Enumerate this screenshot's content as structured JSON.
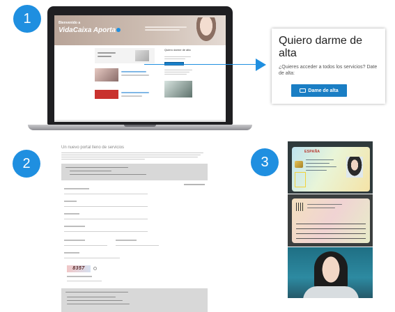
{
  "steps": [
    "1",
    "2",
    "3"
  ],
  "laptop_site": {
    "banner_kicker": "Bienvenido a",
    "banner_brand": "VidaCaixa Aporta",
    "column_heading": "Quiero darme de alta"
  },
  "callout": {
    "title": "Quiero darme de alta",
    "text": "¿Quieres acceder a todos los servicios? Date de alta:",
    "button_label": "Dame de alta"
  },
  "form": {
    "title": "Un nuevo portal lleno de servicios",
    "captcha_text": "8357"
  },
  "id_card": {
    "country": "ESPAÑA"
  },
  "colors": {
    "accent": "#1f8fe0",
    "button": "#1a7ec4"
  }
}
